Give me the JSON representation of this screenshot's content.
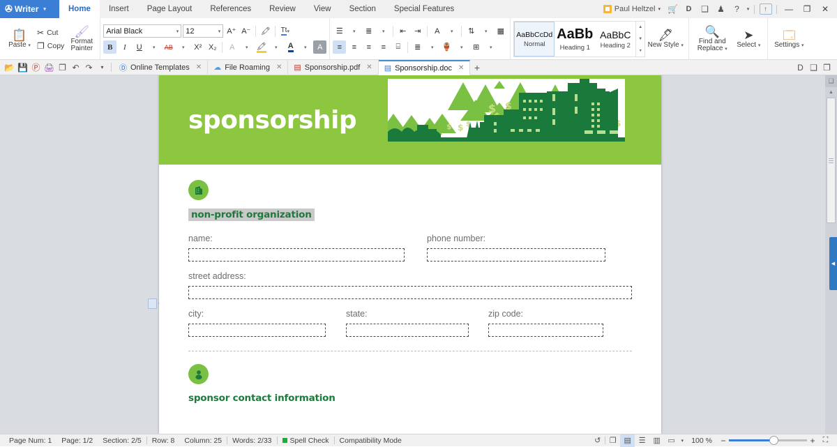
{
  "app": {
    "brand": "Writer",
    "brand_icon": "writer-logo-icon",
    "brand_caret": "▾"
  },
  "titlebar": {
    "ribbon_tabs": [
      {
        "label": "Home",
        "active": true
      },
      {
        "label": "Insert",
        "active": false
      },
      {
        "label": "Page Layout",
        "active": false
      },
      {
        "label": "References",
        "active": false
      },
      {
        "label": "Review",
        "active": false
      },
      {
        "label": "View",
        "active": false
      },
      {
        "label": "Section",
        "active": false
      },
      {
        "label": "Special Features",
        "active": false
      }
    ],
    "user": "Paul Heltzel",
    "user_caret": "▾",
    "icons": [
      {
        "name": "cart-icon",
        "glyph": "🛒"
      },
      {
        "name": "pdf-icon",
        "glyph": "D"
      },
      {
        "name": "image-icon",
        "glyph": "❑"
      },
      {
        "name": "shirt-icon",
        "glyph": "♟"
      },
      {
        "name": "help-icon",
        "glyph": "?"
      },
      {
        "name": "help-caret",
        "glyph": "▾"
      }
    ],
    "share_icon": "↑",
    "minimize": "—",
    "restore": "❐",
    "close": "✕"
  },
  "ribbon": {
    "clipboard": {
      "paste_label": "Paste",
      "paste_caret": "▾",
      "paste_icon": "clipboard-icon",
      "cut_label": "Cut",
      "cut_icon": "scissors-icon",
      "copy_label": "Copy",
      "copy_icon": "copy-icon",
      "format_painter_label": "Format Painter",
      "format_painter_icon": "paintbrush-icon"
    },
    "font": {
      "family": "Arial Black",
      "size": "12",
      "caret": "▾",
      "grow_font": "A⁺",
      "shrink_font": "A⁻",
      "clear_format": "clear-formatting-icon",
      "text_tool": "Tt",
      "bold": "B",
      "italic": "I",
      "underline": "U",
      "strikethrough": "AB",
      "superscript": "X²",
      "subscript": "X₂",
      "char_border": "A",
      "highlight": "highlight-icon",
      "font_color": "A",
      "char_shading": "A"
    },
    "paragraph": {
      "bullets": "bullet-list-icon",
      "numbering": "numbered-list-icon",
      "decrease_indent": "decrease-indent-icon",
      "increase_indent": "increase-indent-icon",
      "asian_layout": "A",
      "sort": "sort-icon",
      "show_marks": "show-formatting-icon",
      "align_left": "align-left-icon",
      "align_center": "align-center-icon",
      "align_right": "align-right-icon",
      "justify": "justify-icon",
      "distribute": "distribute-icon",
      "line_spacing": "line-spacing-icon",
      "shading": "shading-icon",
      "borders": "borders-icon"
    },
    "styles": {
      "items": [
        {
          "preview": "AaBbCcDd",
          "name": "Normal",
          "selected": true,
          "size": "normal"
        },
        {
          "preview": "AaBb",
          "name": "Heading 1",
          "selected": false,
          "size": "h1"
        },
        {
          "preview": "AaBbC",
          "name": "Heading 2",
          "selected": false,
          "size": "h2"
        }
      ],
      "nav_up": "▲",
      "nav_down": "▼",
      "nav_more": "▾"
    },
    "new_style": {
      "label": "New Style",
      "caret": "▾",
      "icon": "new-style-icon"
    },
    "editing": {
      "find_replace_label": "Find and Replace",
      "find_replace_caret": "▾",
      "find_replace_icon": "magnifier-icon",
      "select_label": "Select",
      "select_caret": "▾",
      "select_icon": "cursor-arrow-icon",
      "settings_label": "Settings",
      "settings_caret": "▾",
      "settings_icon": "settings-icon"
    }
  },
  "quickaccess": {
    "icons": [
      {
        "name": "open-folder-icon",
        "glyph": "📂"
      },
      {
        "name": "save-icon",
        "glyph": "💾"
      },
      {
        "name": "export-pdf-icon",
        "glyph": "Ⓟ"
      },
      {
        "name": "print-icon",
        "glyph": "🖨"
      },
      {
        "name": "print-preview-icon",
        "glyph": "❐"
      },
      {
        "name": "undo-icon",
        "glyph": "↶"
      },
      {
        "name": "redo-icon",
        "glyph": "↷"
      },
      {
        "name": "customize-caret-icon",
        "glyph": "▾"
      }
    ],
    "right_icons": [
      {
        "name": "pdf-toolbar-icon",
        "glyph": "D"
      },
      {
        "name": "image-toolbar-icon",
        "glyph": "❑"
      },
      {
        "name": "share-toolbar-icon",
        "glyph": "❐"
      }
    ]
  },
  "doctabs": [
    {
      "label": "Online Templates",
      "icon": "templates-icon",
      "icon_glyph": "Ⓓ",
      "active": false,
      "closable": true
    },
    {
      "label": "File Roaming",
      "icon": "cloud-icon",
      "icon_glyph": "☁",
      "active": false,
      "closable": true
    },
    {
      "label": "Sponsorship.pdf",
      "icon": "pdf-file-icon",
      "icon_glyph": "▤",
      "active": false,
      "closable": true
    },
    {
      "label": "Sponsorship.doc",
      "icon": "doc-file-icon",
      "icon_glyph": "▤",
      "active": true,
      "closable": true
    }
  ],
  "newtab": "+",
  "document": {
    "banner_title": "sponsorship",
    "banner_color": "#8dc63f",
    "artwork": "green-city-skyline-with-trees-and-dollar-signs",
    "sections": [
      {
        "icon": "building-icon",
        "heading": "non-profit organization",
        "selected": true
      },
      {
        "icon": "person-icon",
        "heading": "sponsor contact information",
        "selected": false
      }
    ],
    "fields": {
      "name": "name:",
      "phone": "phone number:",
      "street": "street address:",
      "city": "city:",
      "state": "state:",
      "zip": "zip code:"
    },
    "field_values": {
      "name": "",
      "phone": "",
      "street": "",
      "city": "",
      "state": "",
      "zip": ""
    }
  },
  "statusbar": {
    "page_num": "Page Num: 1",
    "page": "Page: 1/2",
    "section": "Section: 2/5",
    "row": "Row: 8",
    "column": "Column: 25",
    "words": "Words: 2/33",
    "spell_check": "Spell Check",
    "compatibility": "Compatibility Mode",
    "view_icons": [
      {
        "name": "history-icon",
        "glyph": "↺",
        "active": false
      },
      {
        "name": "fullscreen-icon",
        "glyph": "❐",
        "active": false
      },
      {
        "name": "print-layout-icon",
        "glyph": "▤",
        "active": true
      },
      {
        "name": "outline-view-icon",
        "glyph": "☰",
        "active": false
      },
      {
        "name": "web-layout-icon",
        "glyph": "▥",
        "active": false
      },
      {
        "name": "reading-view-icon",
        "glyph": "▭",
        "active": false
      }
    ],
    "view_caret": "▾",
    "zoom_level": "100 %",
    "zoom_minus": "−",
    "zoom_plus": "+",
    "fit_icon": "⛶"
  },
  "scrollbar": {
    "top_icon": "select-browse-object-icon",
    "up_arrow": "▲",
    "collapse_handle": "◀"
  }
}
